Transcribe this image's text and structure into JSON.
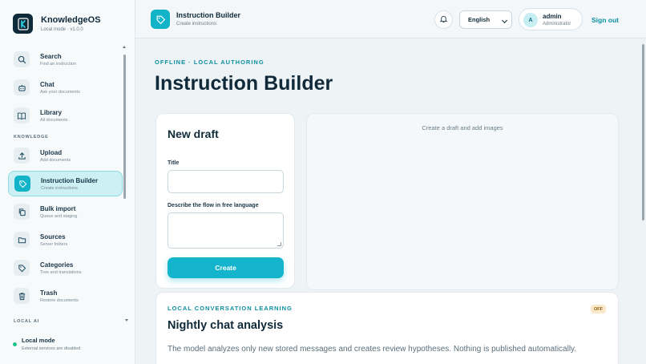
{
  "brand": {
    "name": "KnowledgeOS",
    "version": "Local mode · v1.0.0",
    "logo_letter": "K"
  },
  "sidebar": {
    "items": [
      {
        "label": "Search",
        "sub": "Find an instruction",
        "icon": "search-icon"
      },
      {
        "label": "Chat",
        "sub": "Ask your documents",
        "icon": "bot-icon"
      },
      {
        "label": "Library",
        "sub": "All documents",
        "icon": "book-icon"
      }
    ],
    "knowledge_title": "KNOWLEDGE",
    "knowledge_items": [
      {
        "label": "Upload",
        "sub": "Add documents",
        "icon": "upload-icon"
      },
      {
        "label": "Instruction Builder",
        "sub": "Create instructions",
        "icon": "tag-icon",
        "active": true
      },
      {
        "label": "Bulk import",
        "sub": "Queue and staging",
        "icon": "copy-icon"
      },
      {
        "label": "Sources",
        "sub": "Server folders",
        "icon": "folder-icon"
      },
      {
        "label": "Categories",
        "sub": "Tree and translations",
        "icon": "label-icon"
      },
      {
        "label": "Trash",
        "sub": "Restore documents",
        "icon": "trash-icon"
      }
    ],
    "local_ai_title": "LOCAL AI",
    "local_mode": {
      "label": "Local mode",
      "sub": "External services are disabled",
      "status_color": "#22c08a"
    }
  },
  "topbar": {
    "title": "Instruction Builder",
    "subtitle": "Create instructions",
    "language": "English",
    "user": {
      "initial": "A",
      "name": "admin",
      "role": "Administrator"
    },
    "sign_out": "Sign out"
  },
  "main": {
    "eyebrow": "OFFLINE · LOCAL AUTHORING",
    "title": "Instruction Builder",
    "draft": {
      "title": "New draft",
      "title_label": "Title",
      "title_value": "",
      "flow_label": "Describe the flow in free language",
      "flow_value": "",
      "create_label": "Create"
    },
    "preview_empty": "Create a draft and add images",
    "learning": {
      "eyebrow": "LOCAL CONVERSATION LEARNING",
      "badge": "OFF",
      "title": "Nightly chat analysis",
      "description": "The model analyzes only new stored messages and creates review hypotheses. Nothing is published automatically."
    }
  },
  "colors": {
    "accent": "#14b5cc",
    "dark": "#102a3a",
    "active_bg": "#cdf0f4"
  }
}
